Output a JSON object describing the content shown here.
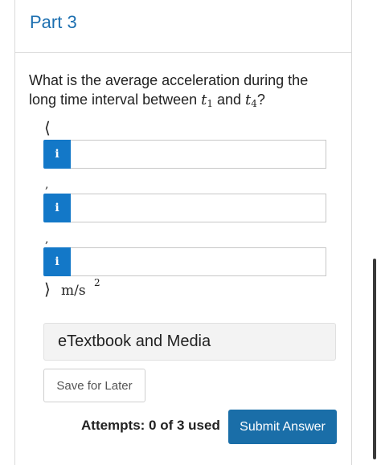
{
  "part": {
    "title": "Part 3"
  },
  "question": {
    "text_before": "What is the average acceleration during the long time interval between ",
    "var1": "t",
    "sub1": "1",
    "connector": " and ",
    "var2": "t",
    "sub2": "4",
    "text_after": "?"
  },
  "vector": {
    "open_bracket": "⟨",
    "close_bracket": "⟩",
    "separator": ",",
    "info_glyph": "i",
    "components": [
      {
        "value": ""
      },
      {
        "value": ""
      },
      {
        "value": ""
      }
    ],
    "units": "m/s",
    "units_exponent": "2"
  },
  "etextbook": {
    "label": "eTextbook and Media"
  },
  "save": {
    "label": "Save for Later"
  },
  "attempts": {
    "text": "Attempts: 0 of 3 used"
  },
  "submit": {
    "label": "Submit Answer"
  },
  "colors": {
    "accent": "#1c6fb0",
    "info_button": "#1378c8",
    "submit_button": "#1a6ea8"
  },
  "icons": {
    "info": "info-icon"
  }
}
